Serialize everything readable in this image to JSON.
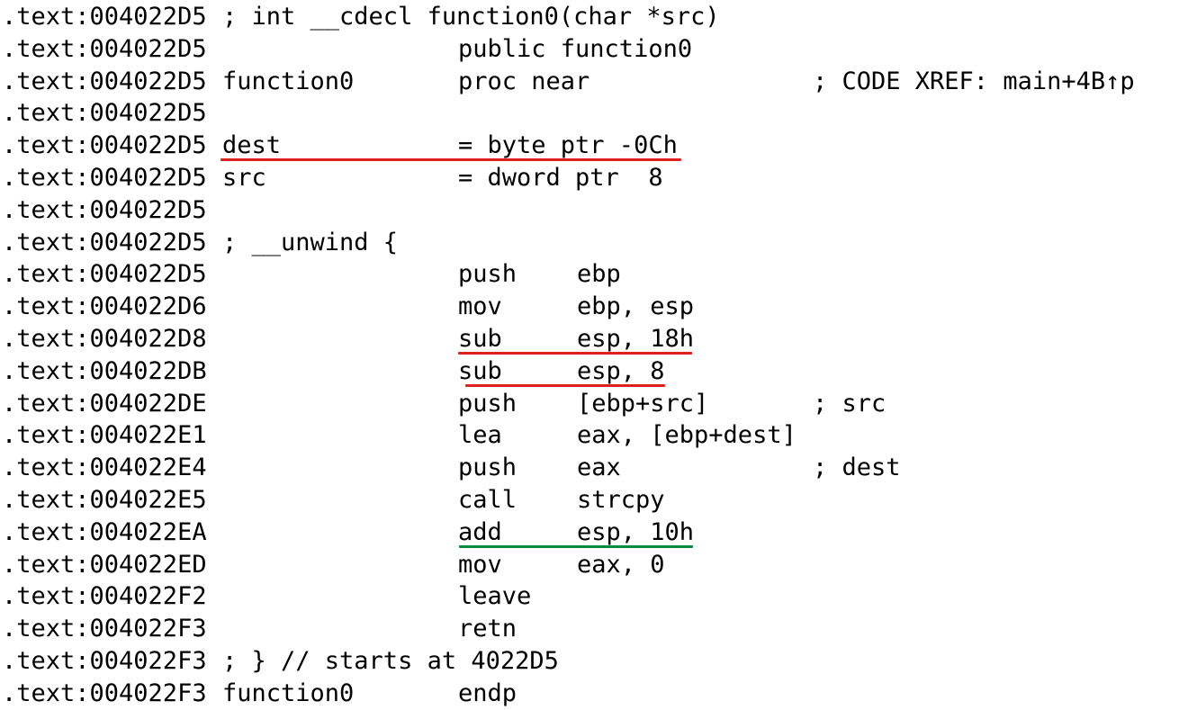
{
  "colors": {
    "background": "#ffffff",
    "text": "#000000",
    "underline_red": "#e0201e",
    "underline_green": "#0a8a3c"
  },
  "lines": [
    {
      "address": ".text:004022D5",
      "label": "; int __cdecl function0(char *src)",
      "mnemonic": "",
      "operands": "",
      "comment": ""
    },
    {
      "address": ".text:004022D5",
      "label": "",
      "mnemonic": "public function0",
      "operands": "",
      "comment": ""
    },
    {
      "address": ".text:004022D5",
      "label": "function0",
      "mnemonic": "proc near",
      "operands": "",
      "comment": "; CODE XREF: main+4B↑p"
    },
    {
      "address": ".text:004022D5",
      "label": "",
      "mnemonic": "",
      "operands": "",
      "comment": ""
    },
    {
      "address": ".text:004022D5",
      "label": "dest",
      "mnemonic": "= byte ptr -0Ch",
      "operands": "",
      "comment": ""
    },
    {
      "address": ".text:004022D5",
      "label": "src",
      "mnemonic": "= dword ptr  8",
      "operands": "",
      "comment": ""
    },
    {
      "address": ".text:004022D5",
      "label": "",
      "mnemonic": "",
      "operands": "",
      "comment": ""
    },
    {
      "address": ".text:004022D5",
      "label": "; __unwind {",
      "mnemonic": "",
      "operands": "",
      "comment": ""
    },
    {
      "address": ".text:004022D5",
      "label": "",
      "mnemonic": "push",
      "operands": "ebp",
      "comment": ""
    },
    {
      "address": ".text:004022D6",
      "label": "",
      "mnemonic": "mov",
      "operands": "ebp, esp",
      "comment": ""
    },
    {
      "address": ".text:004022D8",
      "label": "",
      "mnemonic": "sub",
      "operands": "esp, 18h",
      "comment": ""
    },
    {
      "address": ".text:004022DB",
      "label": "",
      "mnemonic": "sub",
      "operands": "esp, 8",
      "comment": ""
    },
    {
      "address": ".text:004022DE",
      "label": "",
      "mnemonic": "push",
      "operands": "[ebp+src]",
      "comment": "; src"
    },
    {
      "address": ".text:004022E1",
      "label": "",
      "mnemonic": "lea",
      "operands": "eax, [ebp+dest]",
      "comment": ""
    },
    {
      "address": ".text:004022E4",
      "label": "",
      "mnemonic": "push",
      "operands": "eax",
      "comment": "; dest"
    },
    {
      "address": ".text:004022E5",
      "label": "",
      "mnemonic": "call",
      "operands": "strcpy",
      "comment": ""
    },
    {
      "address": ".text:004022EA",
      "label": "",
      "mnemonic": "add",
      "operands": "esp, 10h",
      "comment": ""
    },
    {
      "address": ".text:004022ED",
      "label": "",
      "mnemonic": "mov",
      "operands": "eax, 0",
      "comment": ""
    },
    {
      "address": ".text:004022F2",
      "label": "",
      "mnemonic": "leave",
      "operands": "",
      "comment": ""
    },
    {
      "address": ".text:004022F3",
      "label": "",
      "mnemonic": "retn",
      "operands": "",
      "comment": ""
    },
    {
      "address": ".text:004022F3",
      "label": "; } // starts at 4022D5",
      "mnemonic": "",
      "operands": "",
      "comment": ""
    },
    {
      "address": ".text:004022F3",
      "label": "function0",
      "mnemonic": "endp",
      "operands": "",
      "comment": ""
    }
  ]
}
